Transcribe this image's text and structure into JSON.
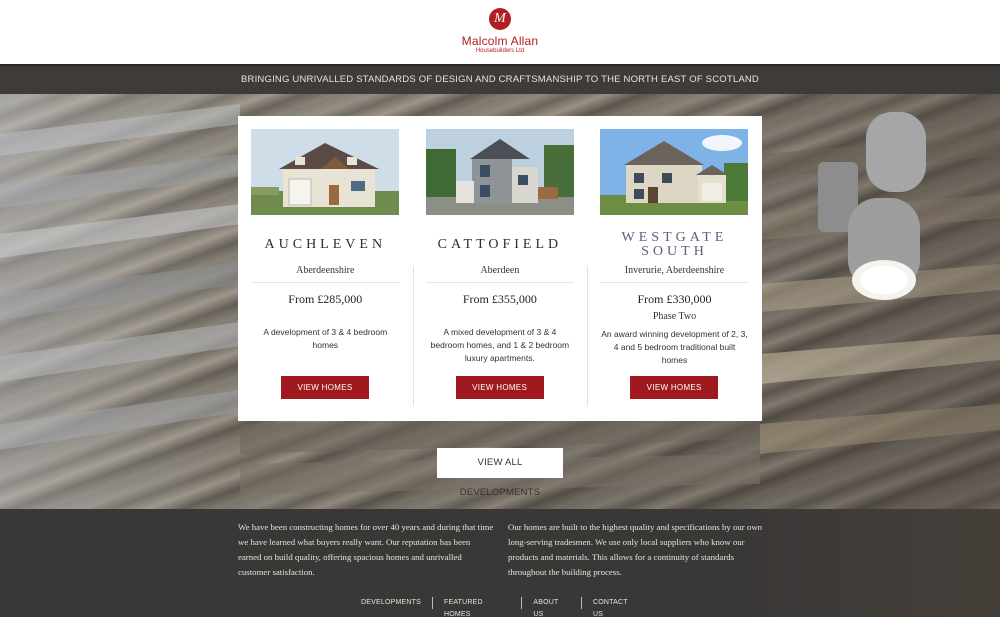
{
  "header": {
    "logo_mark": "M",
    "company_name": "Malcolm Allan",
    "company_sub": "Housebuilders Ltd"
  },
  "tagline": "BRINGING UNRIVALLED STANDARDS OF DESIGN AND CRAFTSMANSHIP TO THE NORTH EAST OF SCOTLAND",
  "developments": [
    {
      "title": "AUCHLEVEN",
      "location": "Aberdeenshire",
      "price": "From £285,000",
      "phase": "",
      "description": "A development of 3 & 4 bedroom homes",
      "button": "VIEW HOMES"
    },
    {
      "title": "CATTOFIELD",
      "location": "Aberdeen",
      "price": "From £355,000",
      "phase": "",
      "description": "A mixed development of 3 & 4 bedroom homes, and 1 & 2 bedroom luxury apartments.",
      "button": "VIEW HOMES"
    },
    {
      "title": "WESTGATE SOUTH",
      "location": "Inverurie, Aberdeenshire",
      "price": "From £330,000",
      "phase": "Phase Two",
      "description": "An award winning development of 2, 3, 4 and 5 bedroom traditional built homes",
      "button": "VIEW HOMES"
    }
  ],
  "view_all": "VIEW ALL DEVELOPMENTS",
  "footer": {
    "left_text": "We have been constructing homes for over 40 years and during that time we have learned what buyers really want. Our reputation has been earned on build quality, offering spacious homes and unrivalled customer satisfaction.",
    "right_text": "Our homes are built to the highest quality and specifications by our own long-serving tradesmen. We use only local suppliers who know our products and materials. This allows for a continuity of standards throughout the building process.",
    "nav": [
      "DEVELOPMENTS",
      "FEATURED HOMES",
      "ABOUT US",
      "CONTACT US"
    ]
  },
  "colors": {
    "brand_red": "#b01e23",
    "button_red": "#a0191f",
    "tagline_bar": "#3f3b38",
    "footer_bg": "#3a3837"
  }
}
